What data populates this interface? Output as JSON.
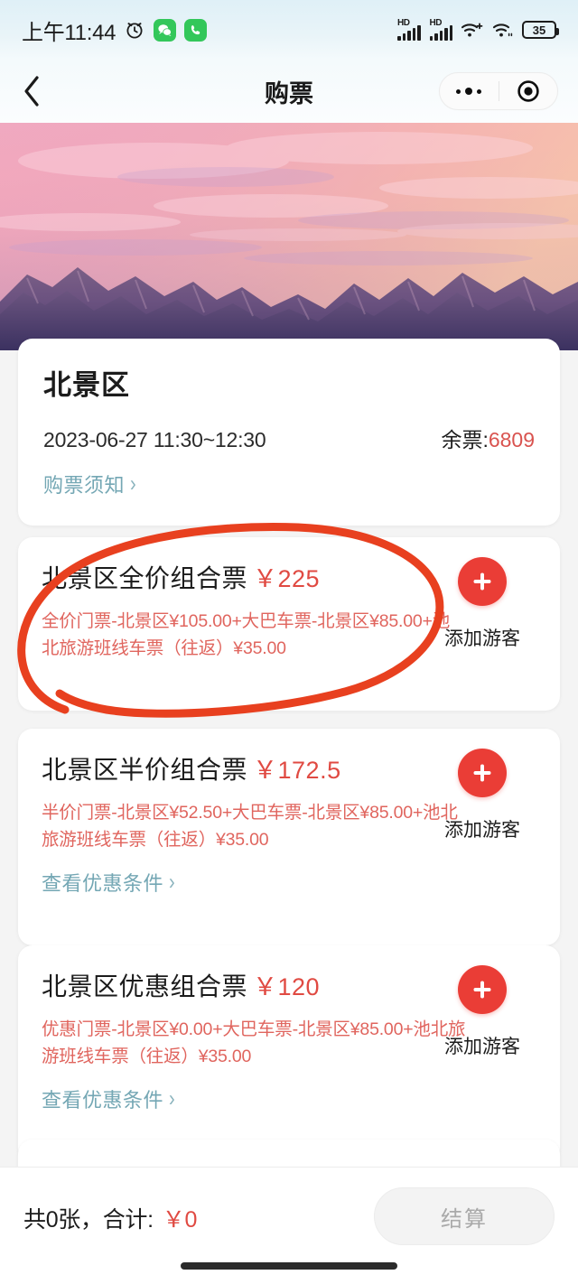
{
  "status_bar": {
    "time": "上午11:44",
    "alarm_icon": "alarm-clock-icon",
    "app_icons": [
      "wechat-icon",
      "phone-call-icon"
    ],
    "signal_label_1": "HD",
    "signal_label_2": "HD",
    "wifi_icons": [
      "wifi-plus-icon",
      "wifi-icon"
    ],
    "battery_level": "35"
  },
  "nav": {
    "back_icon": "back-chevron-icon",
    "title": "购票",
    "capsule_more_icon": "more-dots-icon",
    "capsule_target_icon": "target-circle-icon"
  },
  "hero": {
    "alt": "changbai-mountain-sunset-banner"
  },
  "info_card": {
    "title": "北景区",
    "date_range": "2023-06-27 11:30~12:30",
    "stock_label": "余票:",
    "stock_value": "6809",
    "notice_link": "购票须知",
    "chevron": "›"
  },
  "tickets": [
    {
      "name": "北景区全价组合票",
      "price": "￥225",
      "desc": "全价门票-北景区¥105.00+大巴车票-北景区¥85.00+池北旅游班线车票（往返）¥35.00",
      "add_label": "添加游客",
      "plus_icon": "plus-circle-icon",
      "discount_link": null
    },
    {
      "name": "北景区半价组合票",
      "price": "￥172.5",
      "desc": "半价门票-北景区¥52.50+大巴车票-北景区¥85.00+池北旅游班线车票（往返）¥35.00",
      "add_label": "添加游客",
      "plus_icon": "plus-circle-icon",
      "discount_link": "查看优惠条件"
    },
    {
      "name": "北景区优惠组合票",
      "price": "￥120",
      "desc": "优惠门票-北景区¥0.00+大巴车票-北景区¥85.00+池北旅游班线车票（往返）¥35.00",
      "add_label": "添加游客",
      "plus_icon": "plus-circle-icon",
      "discount_link": "查看优惠条件"
    }
  ],
  "bottom_bar": {
    "summary": "共0张，合计:",
    "amount": "￥0",
    "checkout_label": "结算"
  },
  "annotation": {
    "shape": "hand-drawn-red-ellipse",
    "color": "#e8401f",
    "target": "北景区全价组合票"
  },
  "colors": {
    "accent_red": "#ea3d36",
    "price_red": "#e04a42",
    "desc_red": "#e0655e",
    "link_teal": "#74a7b4",
    "annotation_red": "#e8401f"
  }
}
